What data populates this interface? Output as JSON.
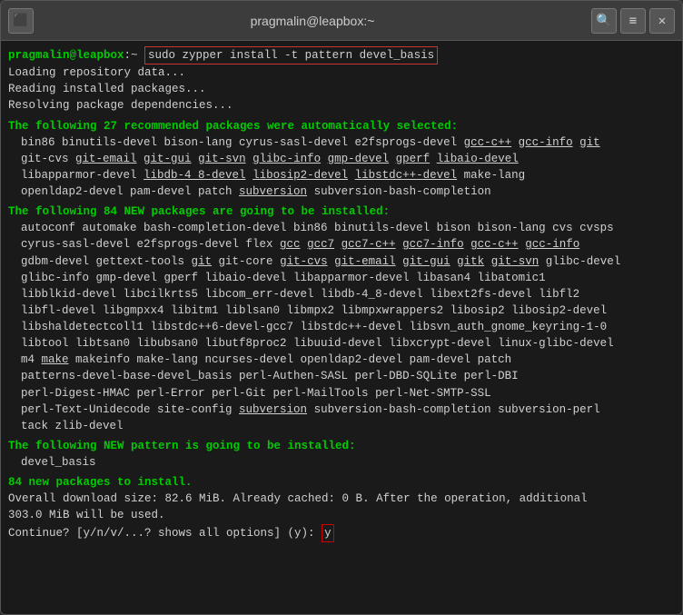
{
  "window": {
    "title": "pragmalin@leapbox:~",
    "icon": "⬛",
    "search_label": "🔍",
    "menu_label": "≡",
    "close_label": "✕"
  },
  "terminal": {
    "prompt_user": "pragmalin@leapbox",
    "prompt_tilde": "~",
    "command": "sudo zypper install -t pattern devel_basis",
    "line1": "Loading repository data...",
    "line2": "Reading installed packages...",
    "line3": "Resolving package dependencies...",
    "section1": "The following 27 recommended packages were automatically selected:",
    "section1_packages": "bin86 binutils-devel bison-lang cyrus-sasl-devel e2fsprogs-devel gcc-c++ gcc-info git\ngit-cvs git-email git-gui git-svn glibc-info gmp-devel gperf libaio-devel\nlibapparmor-devel libdb-4_8-devel libosip2-devel libstdc++-devel make-lang\nopenldap2-devel pam-devel patch subversion subversion-bash-completion",
    "section2": "The following 84 NEW packages are going to be installed:",
    "section2_packages": "autoconf automake bash-completion-devel bin86 binutils-devel bison bison-lang cvs cvsps\ncyrus-sasl-devel e2fsprogs-devel flex gcc gcc7 gcc7-c++ gcc7-info gcc-c++ gcc-info\ngdbm-devel gettext-tools git git-core git-cvs git-email git-gui gitk git-svn glibc-devel\nglibc-info gmp-devel gperf libaio-devel libapparmor-devel libasan4 libatomic1\nlibblkid-devel libcilkrts5 libcom_err-devel libdb-4_8-devel libext2fs-devel libfl2\nlibfl-devel libgmpxx4 libitm1 liblsan0 libmpx2 libmpxwrappers2 libosip2 libosip2-devel\nlibshaldetectcoll1 libstdc++6-devel-gcc7 libstdc++-devel libsvn_auth_gnome_keyring-1-0\nlibtool libtsan0 libubsan0 libutf8proc2 libuuid-devel libxcrypt-devel linux-glibc-devel\nm4 make makeinfo make-lang ncurses-devel openldap2-devel pam-devel patch\npatterns-devel-base-devel_basis perl-Authen-SASL perl-DBD-SQLite perl-DBI\nperl-Digest-HMAC perl-Error perl-Git perl-MailTools perl-Net-SMTP-SSL\nperl-Text-Unidecode site-config subversion subversion-bash-completion subversion-perl\ntack zlib-devel",
    "section3": "The following NEW pattern is going to be installed:",
    "section3_packages": "devel_basis",
    "summary1": "84 new packages to install.",
    "summary2": "Overall download size: 82.6 MiB. Already cached: 0 B. After the operation, additional",
    "summary3": "303.0 MiB will be used.",
    "prompt_line": "Continue? [y/n/v/...? shows all options] (y):",
    "answer": "y"
  }
}
